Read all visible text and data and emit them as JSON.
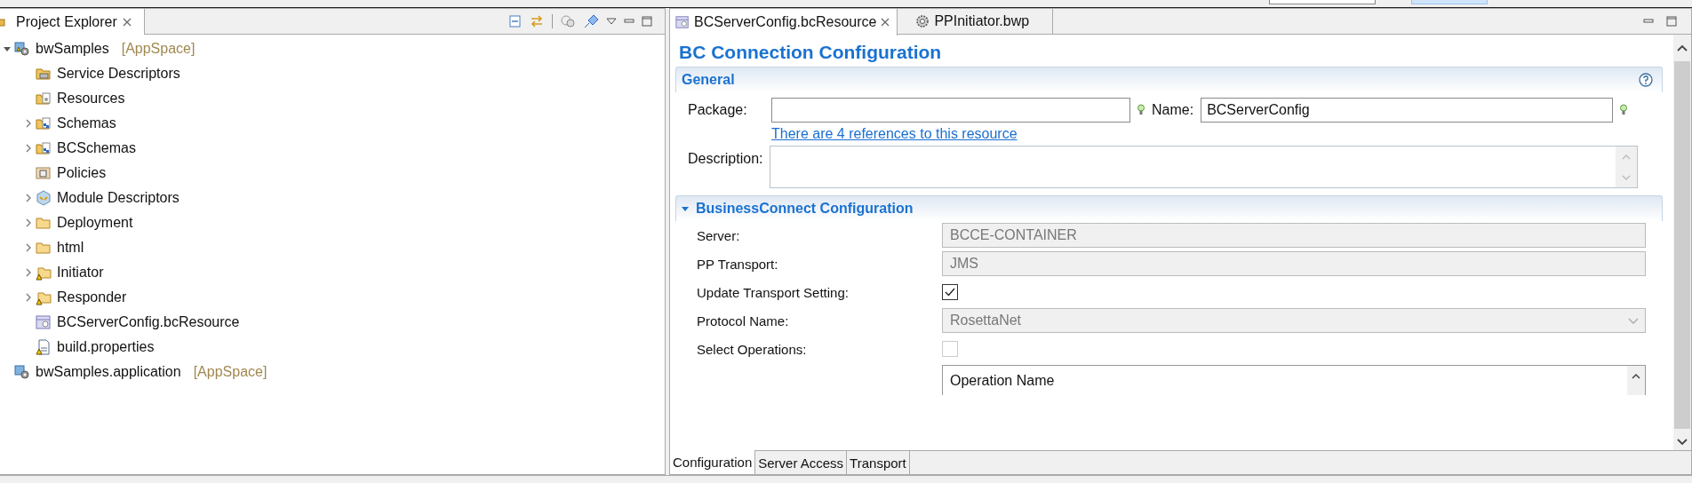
{
  "project_explorer": {
    "title": "Project Explorer",
    "tree": [
      {
        "label": "bwSamples",
        "suffix": "[AppSpace]",
        "kind": "project",
        "expanded": true,
        "children": [
          {
            "label": "Service Descriptors",
            "kind": "service-folder"
          },
          {
            "label": "Resources",
            "kind": "resource-folder"
          },
          {
            "label": "Schemas",
            "kind": "schema-folder",
            "expanded": false
          },
          {
            "label": "BCSchemas",
            "kind": "schema-folder",
            "expanded": false
          },
          {
            "label": "Policies",
            "kind": "policy"
          },
          {
            "label": "Module Descriptors",
            "kind": "module",
            "expanded": false
          },
          {
            "label": "Deployment",
            "kind": "folder",
            "expanded": false
          },
          {
            "label": "html",
            "kind": "folder",
            "expanded": false
          },
          {
            "label": "Initiator",
            "kind": "warning-folder",
            "expanded": false
          },
          {
            "label": "Responder",
            "kind": "warning-folder",
            "expanded": false
          },
          {
            "label": "BCServerConfig.bcResource",
            "kind": "bcresource"
          },
          {
            "label": "build.properties",
            "kind": "properties"
          }
        ]
      },
      {
        "label": "bwSamples.application",
        "suffix": "[AppSpace]",
        "kind": "application"
      }
    ]
  },
  "editor": {
    "tabs": [
      {
        "label": "BCServerConfig.bcResource",
        "kind": "bcresource",
        "selected": true
      },
      {
        "label": "PPInitiator.bwp",
        "kind": "process",
        "selected": false
      }
    ],
    "title": "BC Connection Configuration",
    "general": {
      "title": "General",
      "package": {
        "label": "Package:"
      },
      "name": {
        "label": "Name:",
        "value": "BCServerConfig"
      },
      "link": "There are 4 references to this resource",
      "description": {
        "label": "Description:"
      }
    },
    "businessconnect": {
      "title": "BusinessConnect Configuration",
      "expanded": true,
      "rows": [
        {
          "label": "Server:",
          "kind": "text",
          "value": "BCCE-CONTAINER",
          "disabled": true
        },
        {
          "label": "PP Transport:",
          "kind": "text",
          "value": "JMS",
          "disabled": true
        },
        {
          "label": "Update Transport Setting:",
          "kind": "checkbox",
          "checked": true,
          "disabled": false
        },
        {
          "label": "Protocol Name:",
          "kind": "combo",
          "value": "RosettaNet",
          "disabled": true
        },
        {
          "label": "Select Operations:",
          "kind": "checkbox",
          "checked": false,
          "disabled": true
        }
      ],
      "table": {
        "columns": [
          "Operation Name"
        ]
      }
    },
    "bottom_tabs": [
      {
        "label": "Configuration",
        "selected": true
      },
      {
        "label": "Server Access",
        "selected": false
      },
      {
        "label": "Transport",
        "selected": false
      }
    ]
  }
}
